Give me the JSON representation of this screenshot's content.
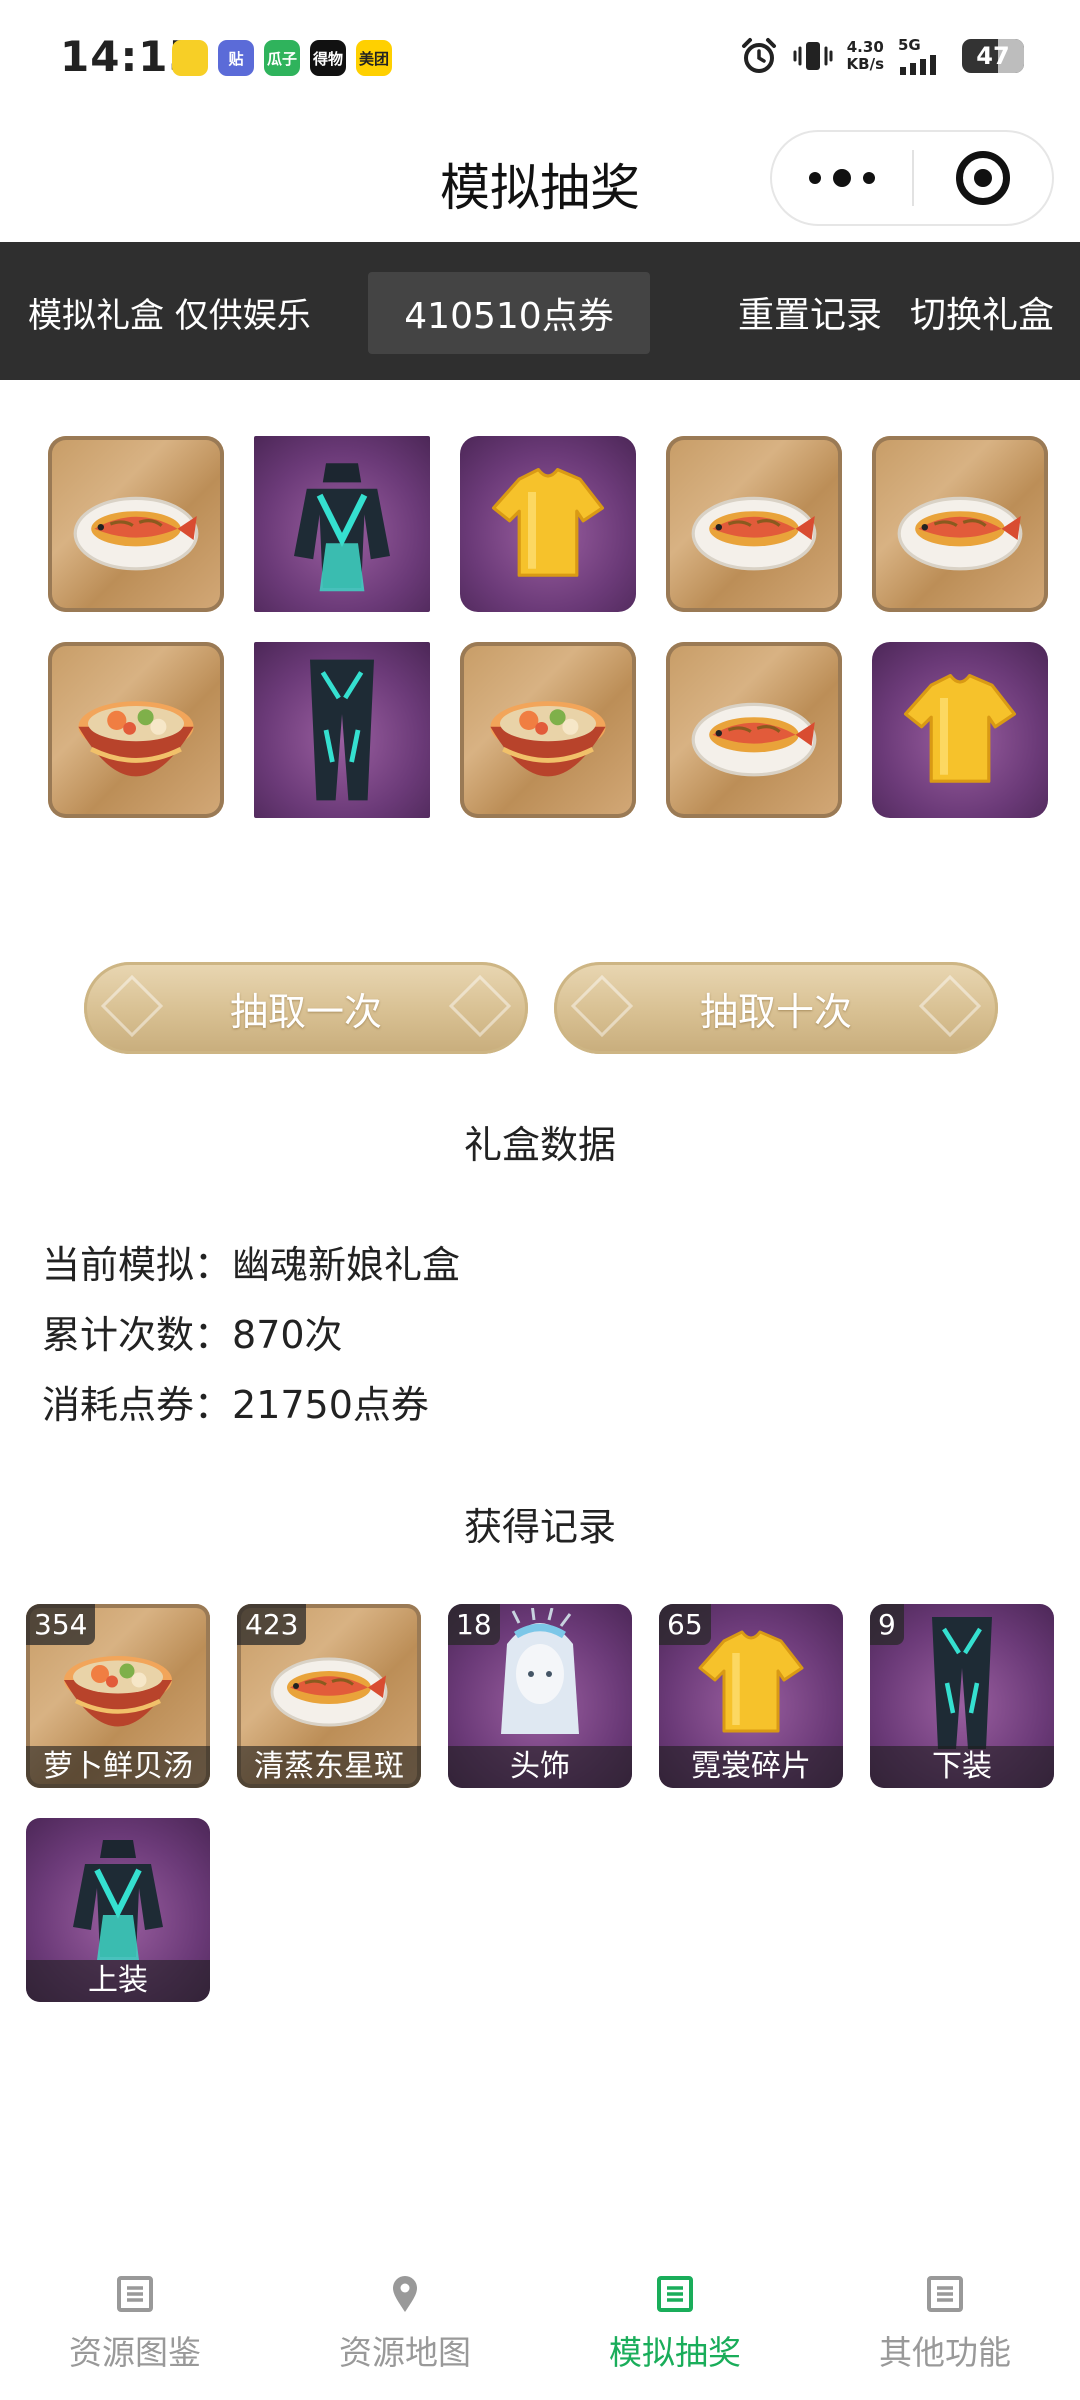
{
  "status_bar": {
    "time": "14:15",
    "net_speed_value": "4.30",
    "net_speed_unit": "KB/s",
    "network": "5G",
    "battery": "47",
    "app_icons": [
      {
        "name": "qq-music-icon",
        "label": "",
        "color": "#f7cf26"
      },
      {
        "name": "tieba-icon",
        "label": "贴",
        "color": "#5b6bd8"
      },
      {
        "name": "guazi-icon",
        "label": "瓜子",
        "color": "#2fb35c"
      },
      {
        "name": "dewu-icon",
        "label": "得物",
        "color": "#111111"
      },
      {
        "name": "meituan-icon",
        "label": "美团",
        "color": "#ffd000"
      }
    ]
  },
  "nav": {
    "title": "模拟抽奖"
  },
  "toolbar": {
    "note": "模拟礼盒 仅供娱乐",
    "points": "410510点券",
    "reset_label": "重置记录",
    "switch_label": "切换礼盒"
  },
  "results": [
    {
      "item": "清蒸东星斑",
      "icon": "steamed-fish-icon",
      "bg": "wood"
    },
    {
      "item": "上装",
      "icon": "top-outfit-icon",
      "bg": "purple"
    },
    {
      "item": "霓裳碎片",
      "icon": "tshirt-shard-icon",
      "bg": "purple"
    },
    {
      "item": "清蒸东星斑",
      "icon": "steamed-fish-icon",
      "bg": "wood"
    },
    {
      "item": "清蒸东星斑",
      "icon": "steamed-fish-icon",
      "bg": "wood"
    },
    {
      "item": "萝卜鲜贝汤",
      "icon": "soup-bowl-icon",
      "bg": "wood"
    },
    {
      "item": "下装",
      "icon": "bottom-outfit-icon",
      "bg": "purple"
    },
    {
      "item": "萝卜鲜贝汤",
      "icon": "soup-bowl-icon",
      "bg": "wood"
    },
    {
      "item": "清蒸东星斑",
      "icon": "steamed-fish-icon",
      "bg": "wood"
    },
    {
      "item": "霓裳碎片",
      "icon": "tshirt-shard-icon",
      "bg": "purple"
    }
  ],
  "buttons": {
    "draw_once": "抽取一次",
    "draw_ten": "抽取十次"
  },
  "data_section": {
    "title": "礼盒数据",
    "current_label": "当前模拟：",
    "current_value": "幽魂新娘礼盒",
    "count_label": "累计次数：",
    "count_value": "870次",
    "spent_label": "消耗点券：",
    "spent_value": "21750点券"
  },
  "records_section": {
    "title": "获得记录",
    "items": [
      {
        "count": "354",
        "name": "萝卜鲜贝汤",
        "icon": "soup-bowl-icon"
      },
      {
        "count": "423",
        "name": "清蒸东星斑",
        "icon": "steamed-fish-icon"
      },
      {
        "count": "18",
        "name": "头饰",
        "icon": "headdress-icon"
      },
      {
        "count": "65",
        "name": "霓裳碎片",
        "icon": "tshirt-shard-icon"
      },
      {
        "count": "9",
        "name": "下装",
        "icon": "bottom-outfit-icon"
      },
      {
        "count": "",
        "name": "上装",
        "icon": "top-outfit-icon"
      }
    ]
  },
  "tabbar": {
    "tabs": [
      {
        "label": "资源图鉴",
        "icon": "list-icon",
        "active": false
      },
      {
        "label": "资源地图",
        "icon": "map-pin-icon",
        "active": false
      },
      {
        "label": "模拟抽奖",
        "icon": "list-icon",
        "active": true
      },
      {
        "label": "其他功能",
        "icon": "list-icon",
        "active": false
      }
    ]
  },
  "colors": {
    "accent_green": "#1aad5a",
    "toolbar_bg": "#2f2f2f",
    "button_gold": "#d8c092"
  }
}
